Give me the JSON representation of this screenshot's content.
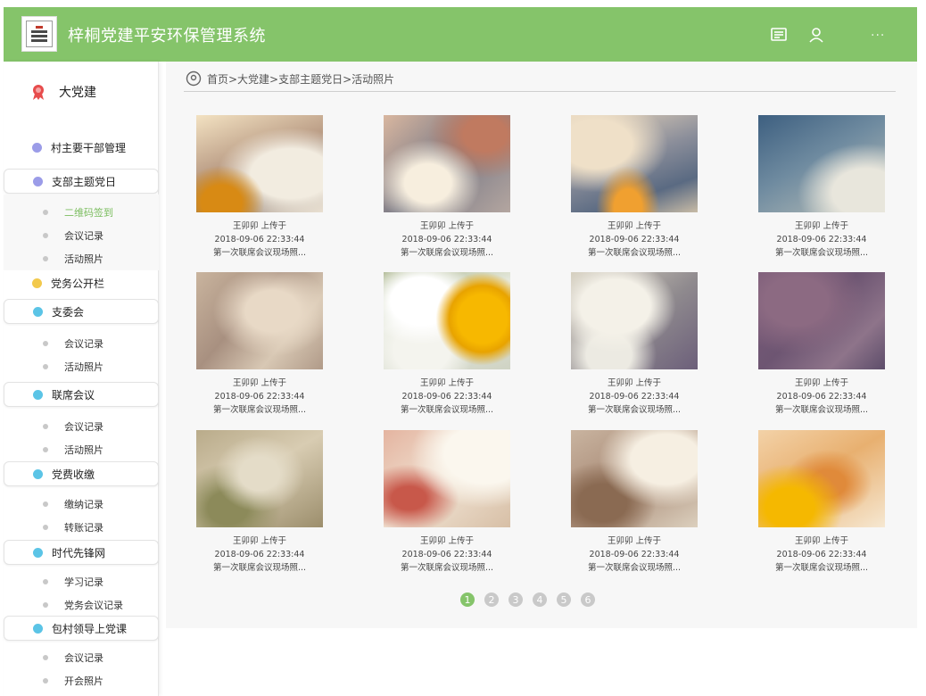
{
  "header": {
    "title": "梓桐党建平安环保管理系统",
    "icons": [
      "message-icon",
      "user-icon",
      "more-icon"
    ],
    "more_label": "···",
    "bg_color": "#85c46a"
  },
  "sidebar": {
    "brand": "大党建",
    "groups": [
      {
        "label": "村主要干部管理",
        "color": "#9b9ce8"
      },
      {
        "label": "支部主题党日",
        "color": "#9b9ce8",
        "items": [
          "二维码签到",
          "会议记录",
          "活动照片"
        ]
      },
      {
        "label": "党务公开栏",
        "color": "#f2c94c"
      },
      {
        "label": "支委会",
        "color": "#5bc4e6",
        "items": [
          "会议记录",
          "活动照片"
        ]
      },
      {
        "label": "联席会议",
        "color": "#5bc4e6",
        "items": [
          "会议记录",
          "活动照片"
        ]
      },
      {
        "label": "党费收缴",
        "color": "#5bc4e6",
        "items": [
          "缴纳记录",
          "转账记录"
        ]
      },
      {
        "label": "时代先锋网",
        "color": "#5bc4e6",
        "items": [
          "学习记录",
          "党务会议记录"
        ]
      },
      {
        "label": "包村领导上党课",
        "color": "#5bc4e6",
        "items": [
          "会议记录",
          "开会照片"
        ]
      }
    ]
  },
  "breadcrumb": "首页>大党建>支部主题党日>活动照片",
  "photos": [
    {
      "uploader": "王卯卯 上传于",
      "time": "2018-09-06  22:33:44",
      "caption": "第一次联席会议现场照..."
    },
    {
      "uploader": "王卯卯 上传于",
      "time": "2018-09-06  22:33:44",
      "caption": "第一次联席会议现场照..."
    },
    {
      "uploader": "王卯卯 上传于",
      "time": "2018-09-06  22:33:44",
      "caption": "第一次联席会议现场照..."
    },
    {
      "uploader": "王卯卯 上传于",
      "time": "2018-09-06  22:33:44",
      "caption": "第一次联席会议现场照..."
    },
    {
      "uploader": "王卯卯 上传于",
      "time": "2018-09-06  22:33:44",
      "caption": "第一次联席会议现场照..."
    },
    {
      "uploader": "王卯卯 上传于",
      "time": "2018-09-06  22:33:44",
      "caption": "第一次联席会议现场照..."
    },
    {
      "uploader": "王卯卯 上传于",
      "time": "2018-09-06  22:33:44",
      "caption": "第一次联席会议现场照..."
    },
    {
      "uploader": "王卯卯 上传于",
      "time": "2018-09-06  22:33:44",
      "caption": "第一次联席会议现场照..."
    },
    {
      "uploader": "王卯卯 上传于",
      "time": "2018-09-06  22:33:44",
      "caption": "第一次联席会议现场照..."
    },
    {
      "uploader": "王卯卯 上传于",
      "time": "2018-09-06  22:33:44",
      "caption": "第一次联席会议现场照..."
    },
    {
      "uploader": "王卯卯 上传于",
      "time": "2018-09-06  22:33:44",
      "caption": "第一次联席会议现场照..."
    },
    {
      "uploader": "王卯卯 上传于",
      "time": "2018-09-06  22:33:44",
      "caption": "第一次联席会议现场照..."
    }
  ],
  "pagination": {
    "pages": [
      "1",
      "2",
      "3",
      "4",
      "5",
      "6"
    ],
    "current": "1"
  }
}
